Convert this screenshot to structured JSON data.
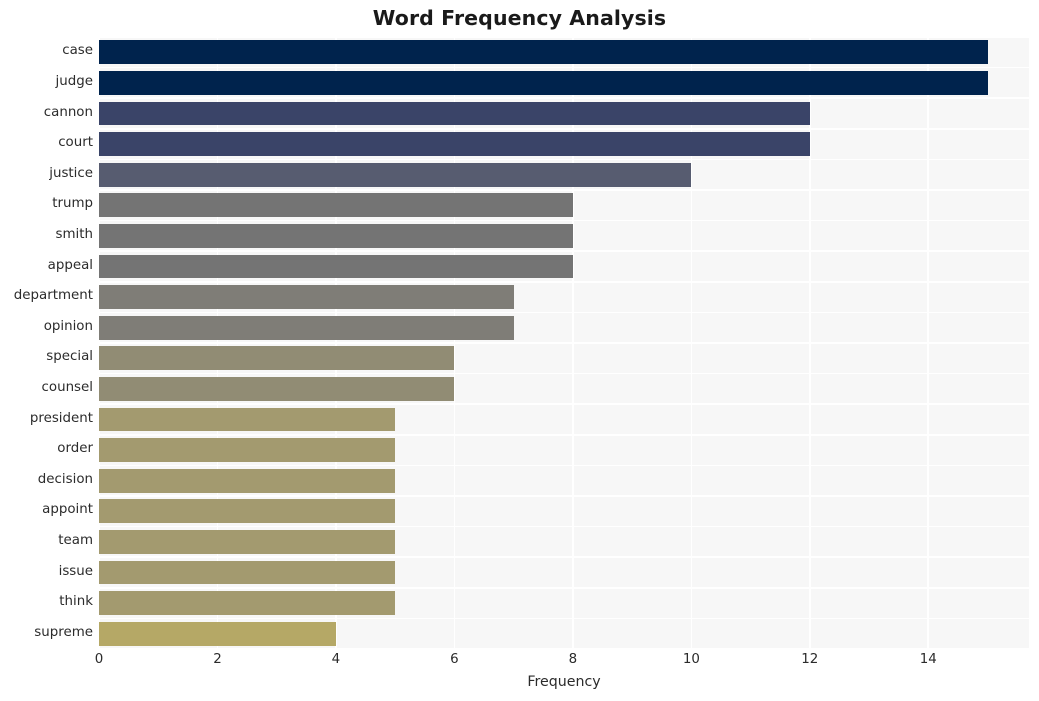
{
  "chart_data": {
    "type": "bar",
    "orientation": "horizontal",
    "title": "Word Frequency Analysis",
    "xlabel": "Frequency",
    "ylabel": "",
    "categories": [
      "case",
      "judge",
      "cannon",
      "court",
      "justice",
      "trump",
      "smith",
      "appeal",
      "department",
      "opinion",
      "special",
      "counsel",
      "president",
      "order",
      "decision",
      "appoint",
      "team",
      "issue",
      "think",
      "supreme"
    ],
    "values": [
      15,
      15,
      12,
      12,
      10,
      8,
      8,
      8,
      7,
      7,
      6,
      6,
      5,
      5,
      5,
      5,
      5,
      5,
      5,
      4
    ],
    "bar_colors": [
      "#00234d",
      "#00234d",
      "#3a4468",
      "#3a4468",
      "#575c70",
      "#747474",
      "#747474",
      "#747474",
      "#7f7d77",
      "#7f7d77",
      "#918c74",
      "#918c74",
      "#a39a6f",
      "#a39a6f",
      "#a39a6f",
      "#a39a6f",
      "#a39a6f",
      "#a39a6f",
      "#a39a6f",
      "#b5a866"
    ],
    "xlim": [
      0,
      15.7
    ],
    "xticks": [
      0,
      2,
      4,
      6,
      8,
      10,
      12,
      14
    ],
    "xtick_labels": [
      "0",
      "2",
      "4",
      "6",
      "8",
      "10",
      "12",
      "14"
    ],
    "grid": true,
    "grid_color": "#ffffff",
    "plot_background": "#f7f7f7",
    "figure_background": "#ffffff",
    "legend": null
  }
}
